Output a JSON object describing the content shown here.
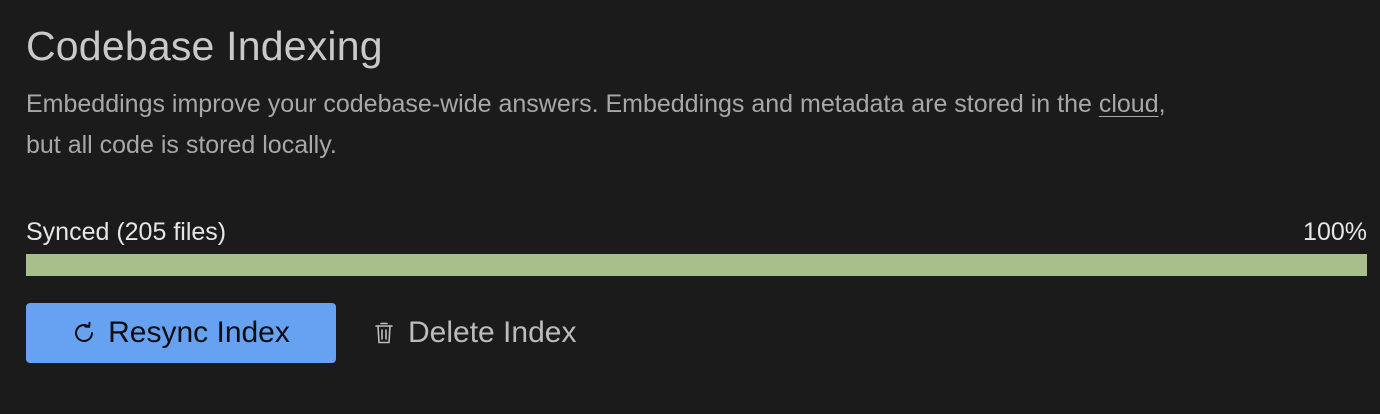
{
  "header": {
    "title": "Codebase Indexing"
  },
  "description": {
    "line1_before_link": "Embeddings improve your codebase-wide answers. Embeddings and metadata are stored in the ",
    "link_text": "cloud",
    "line1_after_link": ",",
    "line2": "but all code is stored locally."
  },
  "status": {
    "label": "Synced (205 files)",
    "percent_text": "100%",
    "progress_fraction": 1.0,
    "progress_color": "#a8bf8c"
  },
  "actions": {
    "resync_label": "Resync Index",
    "resync_icon": "refresh-icon",
    "resync_color": "#66a1f2",
    "delete_label": "Delete Index",
    "delete_icon": "trash-icon"
  }
}
